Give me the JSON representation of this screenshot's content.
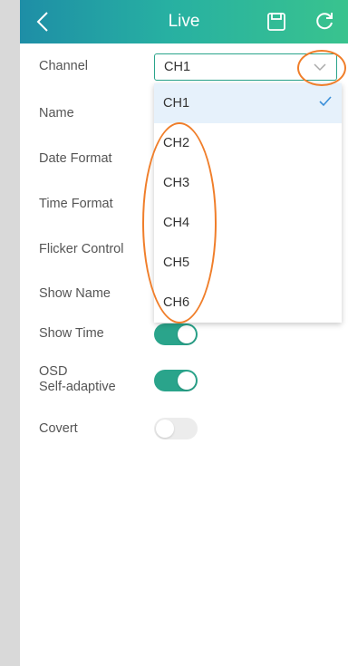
{
  "header": {
    "title": "Live",
    "back_icon": "chevron-left-icon",
    "save_icon": "save-icon",
    "refresh_icon": "refresh-icon",
    "gradient_start": "#1e8ea6",
    "gradient_end": "#39c38e"
  },
  "form": {
    "channel_label": "Channel",
    "channel_value": "CH1",
    "name_label": "Name",
    "date_format_label": "Date Format",
    "time_format_label": "Time Format",
    "flicker_label": "Flicker Control",
    "show_name_label": "Show Name",
    "show_time_label": "Show Time",
    "show_time_on": true,
    "osd_label_line1": "OSD",
    "osd_label_line2": "Self-adaptive",
    "osd_on": true,
    "covert_label": "Covert",
    "covert_on": false
  },
  "dropdown": {
    "options": [
      "CH1",
      "CH2",
      "CH3",
      "CH4",
      "CH5",
      "CH6"
    ],
    "selected": "CH1",
    "check_icon": "check-icon"
  },
  "colors": {
    "accent": "#2aa48b",
    "annotation": "#f07e2a",
    "selected_bg": "#e6f1fb"
  }
}
